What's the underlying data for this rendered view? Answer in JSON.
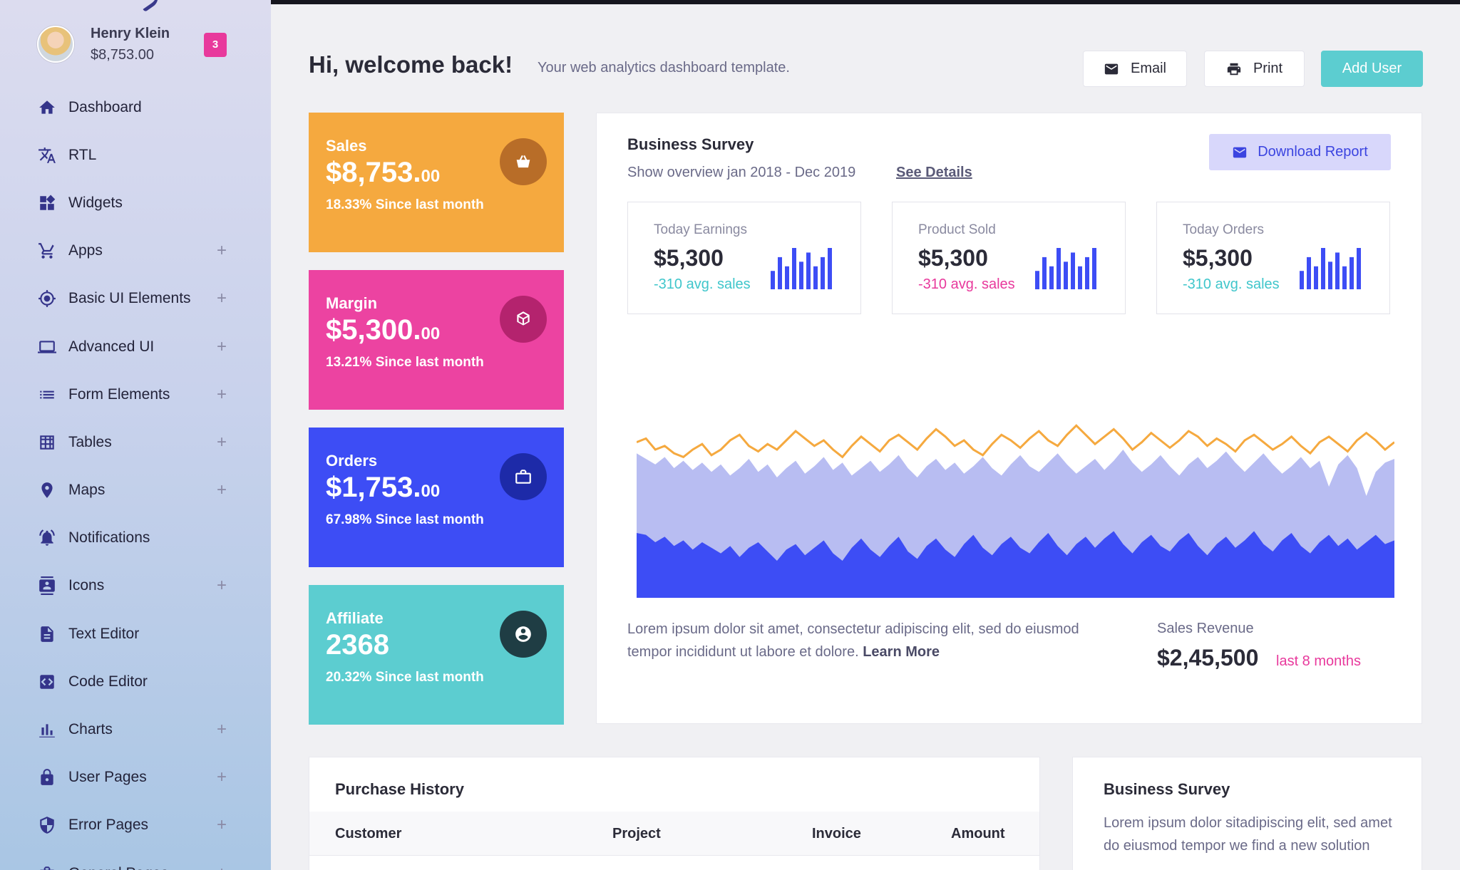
{
  "profile": {
    "name": "Henry Klein",
    "balance": "$8,753.00",
    "badge": "3"
  },
  "sidebar": {
    "items": [
      {
        "label": "Dashboard",
        "icon": "home-icon",
        "expandable": false
      },
      {
        "label": "RTL",
        "icon": "translate-icon",
        "expandable": false
      },
      {
        "label": "Widgets",
        "icon": "widgets-icon",
        "expandable": false
      },
      {
        "label": "Apps",
        "icon": "cart-icon",
        "expandable": true
      },
      {
        "label": "Basic UI Elements",
        "icon": "crosshair-icon",
        "expandable": true
      },
      {
        "label": "Advanced UI",
        "icon": "laptop-icon",
        "expandable": true
      },
      {
        "label": "Form Elements",
        "icon": "list-icon",
        "expandable": true
      },
      {
        "label": "Tables",
        "icon": "table-icon",
        "expandable": true
      },
      {
        "label": "Maps",
        "icon": "map-pin-icon",
        "expandable": true
      },
      {
        "label": "Notifications",
        "icon": "bell-icon",
        "expandable": false
      },
      {
        "label": "Icons",
        "icon": "contacts-icon",
        "expandable": true
      },
      {
        "label": "Text Editor",
        "icon": "document-icon",
        "expandable": false
      },
      {
        "label": "Code Editor",
        "icon": "code-icon",
        "expandable": false
      },
      {
        "label": "Charts",
        "icon": "bar-chart-icon",
        "expandable": true
      },
      {
        "label": "User Pages",
        "icon": "lock-icon",
        "expandable": true
      },
      {
        "label": "Error Pages",
        "icon": "shield-icon",
        "expandable": true
      },
      {
        "label": "General Pages",
        "icon": "briefcase-icon",
        "expandable": true
      }
    ],
    "plus_glyph": "+"
  },
  "header": {
    "greeting": "Hi, welcome back!",
    "subtitle": "Your web analytics dashboard template.",
    "email_label": "Email",
    "print_label": "Print",
    "add_user_label": "Add User"
  },
  "stats": [
    {
      "title": "Sales",
      "value": "$8,753.",
      "cents": "00",
      "foot": "18.33% Since last month",
      "icon": "basket-icon",
      "bg": "#f5a93f",
      "icon_bg": "#b86d28"
    },
    {
      "title": "Margin",
      "value": "$5,300.",
      "cents": "00",
      "foot": "13.21% Since last month",
      "icon": "cube-icon",
      "bg": "#ec43a1",
      "icon_bg": "#b4236e"
    },
    {
      "title": "Orders",
      "value": "$1,753.",
      "cents": "00",
      "foot": "67.98% Since last month",
      "icon": "briefcase-icon",
      "bg": "#3d4df5",
      "icon_bg": "#1d2aa8"
    },
    {
      "title": "Affiliate",
      "value": "2368",
      "cents": "",
      "foot": "20.32% Since last month",
      "icon": "account-icon",
      "bg": "#5ccdd0",
      "icon_bg": "#1f3d44"
    }
  ],
  "survey": {
    "title": "Business Survey",
    "subtitle": "Show overview jan 2018 - Dec 2019",
    "see_details": "See Details",
    "download_label": "Download Report",
    "mini": [
      {
        "label": "Today Earnings",
        "value": "$5,300",
        "delta": "-310 avg. sales",
        "delta_color": "#3fc6cb"
      },
      {
        "label": "Product Sold",
        "value": "$5,300",
        "delta": "-310 avg. sales",
        "delta_color": "#e8399c"
      },
      {
        "label": "Today Orders",
        "value": "$5,300",
        "delta": "-310 avg. sales",
        "delta_color": "#3fc6cb"
      }
    ],
    "lorem": "Lorem ipsum dolor sit amet, consectetur adipiscing elit, sed do eiusmod tempor incididunt ut labore et dolore.",
    "learn_more": "Learn More",
    "revenue_label": "Sales Revenue",
    "revenue_value": "$2,45,500",
    "revenue_note": "last 8 months"
  },
  "purchase": {
    "title": "Purchase History",
    "columns": [
      "Customer",
      "Project",
      "Invoice",
      "Amount"
    ]
  },
  "survey2": {
    "title": "Business Survey",
    "text": "Lorem ipsum dolor sitadipiscing elit, sed amet do eiusmod tempor we find a new solution"
  },
  "chart_data": [
    {
      "type": "bar",
      "name": "mini-bars",
      "values": [
        4,
        7,
        5,
        9,
        6,
        8,
        5,
        7,
        9
      ]
    },
    {
      "type": "area",
      "series": [
        {
          "values": [
            0.54,
            0.56,
            0.5,
            0.52,
            0.48,
            0.46,
            0.5,
            0.53,
            0.47,
            0.5,
            0.55,
            0.58,
            0.52,
            0.49,
            0.53,
            0.5,
            0.55,
            0.6,
            0.56,
            0.52,
            0.55,
            0.5,
            0.46,
            0.52,
            0.57,
            0.53,
            0.49,
            0.55,
            0.58,
            0.54,
            0.5,
            0.56,
            0.61,
            0.57,
            0.52,
            0.55,
            0.5,
            0.47,
            0.53,
            0.58,
            0.55,
            0.51,
            0.56,
            0.6,
            0.55,
            0.52,
            0.58,
            0.63,
            0.58,
            0.53,
            0.57,
            0.61,
            0.56,
            0.5,
            0.54,
            0.59,
            0.55,
            0.51,
            0.55,
            0.6,
            0.57,
            0.52,
            0.56,
            0.53,
            0.49,
            0.55,
            0.58,
            0.54,
            0.5,
            0.53,
            0.57,
            0.52,
            0.48,
            0.54,
            0.57,
            0.53,
            0.49,
            0.55,
            0.59,
            0.55,
            0.5,
            0.54
          ],
          "color": "#f5a93f"
        },
        {
          "values": [
            0.78,
            0.75,
            0.72,
            0.76,
            0.7,
            0.74,
            0.69,
            0.73,
            0.68,
            0.72,
            0.66,
            0.7,
            0.75,
            0.68,
            0.72,
            0.65,
            0.7,
            0.74,
            0.67,
            0.71,
            0.76,
            0.69,
            0.73,
            0.66,
            0.7,
            0.74,
            0.68,
            0.72,
            0.77,
            0.7,
            0.65,
            0.71,
            0.75,
            0.69,
            0.73,
            0.67,
            0.71,
            0.76,
            0.7,
            0.66,
            0.72,
            0.77,
            0.71,
            0.68,
            0.73,
            0.78,
            0.72,
            0.67,
            0.71,
            0.75,
            0.69,
            0.74,
            0.8,
            0.73,
            0.68,
            0.72,
            0.77,
            0.71,
            0.66,
            0.72,
            0.76,
            0.7,
            0.74,
            0.79,
            0.73,
            0.68,
            0.73,
            0.78,
            0.72,
            0.67,
            0.71,
            0.76,
            0.7,
            0.74,
            0.6,
            0.72,
            0.77,
            0.7,
            0.55,
            0.68,
            0.73,
            0.75
          ],
          "color": "#b8bdf2"
        },
        {
          "values": [
            0.35,
            0.34,
            0.3,
            0.33,
            0.28,
            0.31,
            0.26,
            0.3,
            0.27,
            0.24,
            0.28,
            0.22,
            0.27,
            0.3,
            0.25,
            0.2,
            0.26,
            0.29,
            0.23,
            0.27,
            0.31,
            0.24,
            0.2,
            0.27,
            0.32,
            0.26,
            0.22,
            0.28,
            0.33,
            0.25,
            0.21,
            0.28,
            0.32,
            0.26,
            0.22,
            0.29,
            0.34,
            0.27,
            0.23,
            0.29,
            0.33,
            0.27,
            0.24,
            0.3,
            0.35,
            0.28,
            0.23,
            0.29,
            0.33,
            0.27,
            0.32,
            0.36,
            0.29,
            0.24,
            0.3,
            0.34,
            0.28,
            0.25,
            0.31,
            0.35,
            0.28,
            0.23,
            0.29,
            0.33,
            0.27,
            0.31,
            0.36,
            0.29,
            0.25,
            0.31,
            0.35,
            0.28,
            0.24,
            0.3,
            0.34,
            0.28,
            0.32,
            0.26,
            0.3,
            0.34,
            0.29,
            0.31
          ],
          "color": "#3d4df5"
        }
      ]
    }
  ]
}
